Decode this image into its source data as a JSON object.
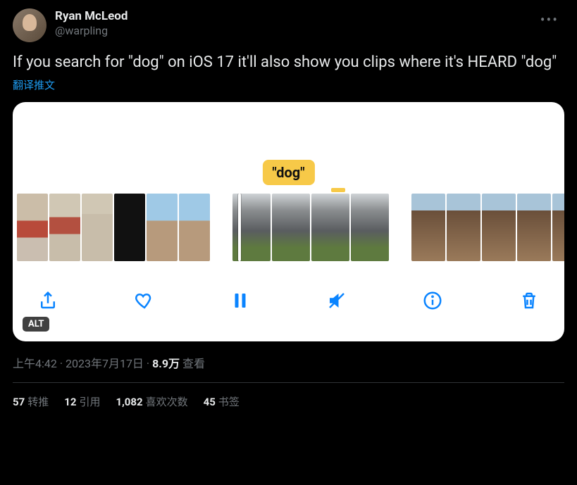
{
  "author": {
    "display_name": "Ryan McLeod",
    "handle": "@warpling"
  },
  "tweet_text": "If you search for \"dog\" on iOS 17 it'll also show you clips where it's HEARD \"dog\"",
  "translate_label": "翻译推文",
  "media": {
    "caption_text": "\"dog\"",
    "alt_badge": "ALT"
  },
  "meta": {
    "time": "上午4:42",
    "dot1": " · ",
    "date": "2023年7月17日",
    "dot2": " · ",
    "views_count": "8.9万",
    "views_label": " 查看"
  },
  "stats": {
    "retweets": {
      "count": "57",
      "label": "转推"
    },
    "quotes": {
      "count": "12",
      "label": "引用"
    },
    "likes": {
      "count": "1,082",
      "label": "喜欢次数"
    },
    "bookmarks": {
      "count": "45",
      "label": "书签"
    }
  }
}
